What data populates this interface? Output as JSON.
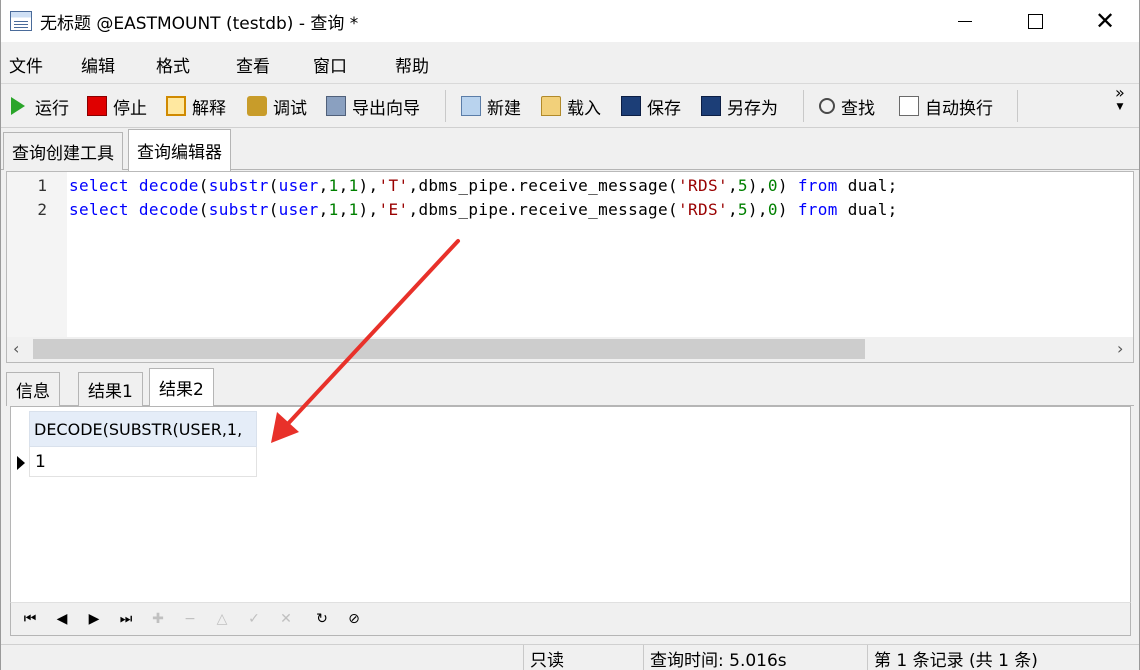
{
  "window": {
    "title": "无标题 @EASTMOUNT (testdb) - 查询 *",
    "controls": [
      "minimize",
      "maximize",
      "close"
    ]
  },
  "menu": {
    "items": [
      "文件",
      "编辑",
      "格式",
      "查看",
      "窗口",
      "帮助"
    ]
  },
  "toolbar": {
    "run": "运行",
    "stop": "停止",
    "explain": "解释",
    "debug": "调试",
    "export_wizard": "导出向导",
    "new": "新建",
    "load": "载入",
    "save": "保存",
    "save_as": "另存为",
    "find": "查找",
    "word_wrap": "自动换行",
    "more": "»"
  },
  "editor_tabs": {
    "tabs": [
      "查询创建工具",
      "查询编辑器"
    ],
    "active": "查询编辑器"
  },
  "editor": {
    "lines": [
      {
        "number": "1",
        "tokens": [
          {
            "t": "kw",
            "v": "select"
          },
          {
            "t": "txt",
            "v": " "
          },
          {
            "t": "kw",
            "v": "decode"
          },
          {
            "t": "txt",
            "v": "("
          },
          {
            "t": "kw",
            "v": "substr"
          },
          {
            "t": "txt",
            "v": "("
          },
          {
            "t": "kw",
            "v": "user"
          },
          {
            "t": "txt",
            "v": ","
          },
          {
            "t": "num",
            "v": "1"
          },
          {
            "t": "txt",
            "v": ","
          },
          {
            "t": "num",
            "v": "1"
          },
          {
            "t": "txt",
            "v": "),"
          },
          {
            "t": "str",
            "v": "'T'"
          },
          {
            "t": "txt",
            "v": ",dbms_pipe.receive_message("
          },
          {
            "t": "str",
            "v": "'RDS'"
          },
          {
            "t": "txt",
            "v": ","
          },
          {
            "t": "num",
            "v": "5"
          },
          {
            "t": "txt",
            "v": "),"
          },
          {
            "t": "num",
            "v": "0"
          },
          {
            "t": "txt",
            "v": ") "
          },
          {
            "t": "kw",
            "v": "from"
          },
          {
            "t": "txt",
            "v": " dual;"
          }
        ]
      },
      {
        "number": "2",
        "tokens": [
          {
            "t": "kw",
            "v": "select"
          },
          {
            "t": "txt",
            "v": " "
          },
          {
            "t": "kw",
            "v": "decode"
          },
          {
            "t": "txt",
            "v": "("
          },
          {
            "t": "kw",
            "v": "substr"
          },
          {
            "t": "txt",
            "v": "("
          },
          {
            "t": "kw",
            "v": "user"
          },
          {
            "t": "txt",
            "v": ","
          },
          {
            "t": "num",
            "v": "1"
          },
          {
            "t": "txt",
            "v": ","
          },
          {
            "t": "num",
            "v": "1"
          },
          {
            "t": "txt",
            "v": "),"
          },
          {
            "t": "str",
            "v": "'E'"
          },
          {
            "t": "txt",
            "v": ",dbms_pipe.receive_message("
          },
          {
            "t": "str",
            "v": "'RDS'"
          },
          {
            "t": "txt",
            "v": ","
          },
          {
            "t": "num",
            "v": "5"
          },
          {
            "t": "txt",
            "v": "),"
          },
          {
            "t": "num",
            "v": "0"
          },
          {
            "t": "txt",
            "v": ") "
          },
          {
            "t": "kw",
            "v": "from"
          },
          {
            "t": "txt",
            "v": " dual;"
          }
        ]
      }
    ],
    "scroll_left_arrow": "‹",
    "scroll_right_arrow": "›"
  },
  "result_tabs": {
    "tabs": [
      "信息",
      "结果1",
      "结果2"
    ],
    "active": "结果2"
  },
  "grid": {
    "columns": [
      "DECODE(SUBSTR(USER,1,"
    ],
    "rows": [
      [
        "1"
      ]
    ]
  },
  "navigator": {
    "buttons": [
      {
        "name": "first-record-button",
        "glyph": "⏮",
        "enabled": true
      },
      {
        "name": "prev-record-button",
        "glyph": "◀",
        "enabled": true
      },
      {
        "name": "next-record-button",
        "glyph": "▶",
        "enabled": true
      },
      {
        "name": "last-record-button",
        "glyph": "⏭",
        "enabled": true
      },
      {
        "name": "add-record-button",
        "glyph": "✚",
        "enabled": false
      },
      {
        "name": "delete-record-button",
        "glyph": "−",
        "enabled": false
      },
      {
        "name": "apply-changes-button",
        "glyph": "△",
        "enabled": false
      },
      {
        "name": "confirm-button",
        "glyph": "✓",
        "enabled": false
      },
      {
        "name": "discard-changes-button",
        "glyph": "✕",
        "enabled": false
      },
      {
        "name": "refresh-button",
        "glyph": "↻",
        "enabled": true
      },
      {
        "name": "stop-button",
        "glyph": "⊘",
        "enabled": true
      }
    ]
  },
  "status": {
    "mode": "只读",
    "query_time": "查询时间: 5.016s",
    "record_info": "第 1 条记录 (共 1 条)"
  },
  "colors": {
    "keyword": "#0000ff",
    "string": "#990000",
    "number": "#008000",
    "annotation_arrow": "#e8312a"
  }
}
